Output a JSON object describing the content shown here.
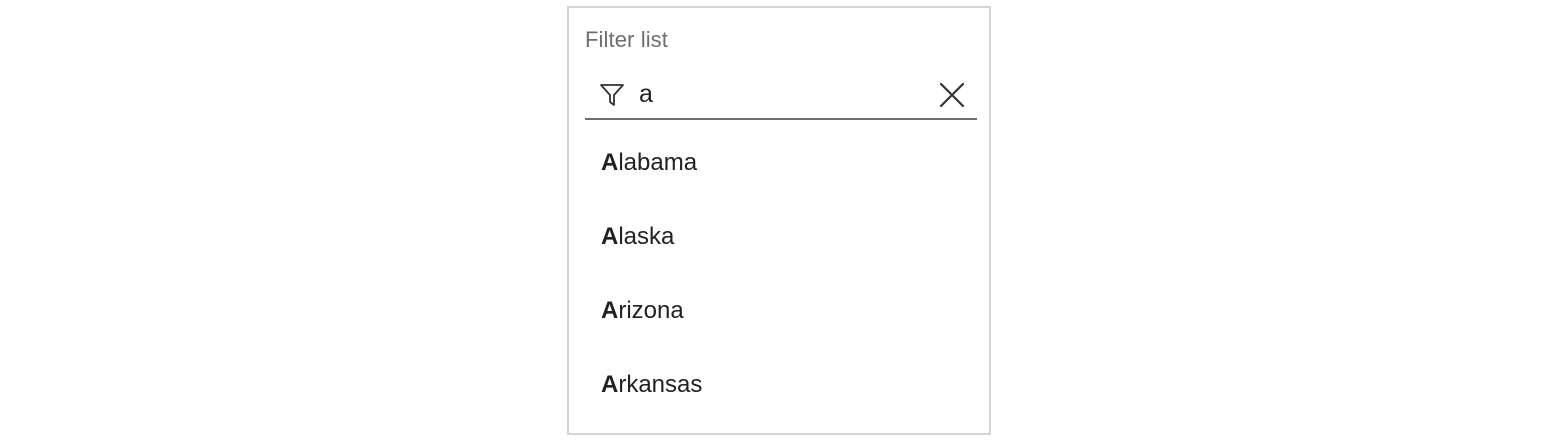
{
  "filter": {
    "label": "Filter list",
    "query": "a",
    "filter_icon": "funnel-icon",
    "clear_icon": "close-icon"
  },
  "results": [
    {
      "match": "A",
      "rest": "labama"
    },
    {
      "match": "A",
      "rest": "laska"
    },
    {
      "match": "A",
      "rest": "rizona"
    },
    {
      "match": "A",
      "rest": "rkansas"
    }
  ]
}
